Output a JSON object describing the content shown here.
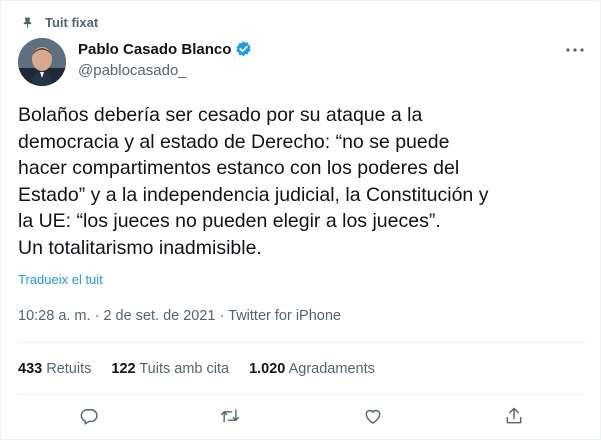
{
  "pinned": {
    "label": "Tuit fixat",
    "icon": "pin-icon"
  },
  "author": {
    "name": "Pablo Casado Blanco",
    "handle": "@pablocasado_",
    "verified_icon": "verified-badge-icon",
    "avatar_icon": "avatar-photo"
  },
  "menu_icon": "more-options-icon",
  "tweet": {
    "lines": [
      "Bolaños debería ser cesado por su ataque a la",
      "democracia y al estado de Derecho: “no se puede",
      "hacer compartimentos estanco con los poderes del",
      "Estado” y a la independencia judicial, la Constitución y",
      "la UE: “los jueces no pueden elegir a los jueces”.",
      "Un totalitarismo inadmisible."
    ],
    "translate": "Tradueix el tuit"
  },
  "meta": {
    "time": "10:28 a. m.",
    "separator1": " · ",
    "date": "2 de set. de 2021",
    "separator2": " · ",
    "source": "Twitter for iPhone"
  },
  "stats": {
    "retweets_count": "433",
    "retweets_label": "Retuits",
    "quotes_count": "122",
    "quotes_label": "Tuits amb cita",
    "likes_count": "1.020",
    "likes_label": "Agradaments"
  },
  "actions": [
    "reply-icon",
    "retweet-icon",
    "like-icon",
    "share-icon"
  ],
  "colors": {
    "accent": "#1d9bf0",
    "text_primary": "#0f1419",
    "text_secondary": "#536471",
    "divider": "#eff3f4"
  }
}
